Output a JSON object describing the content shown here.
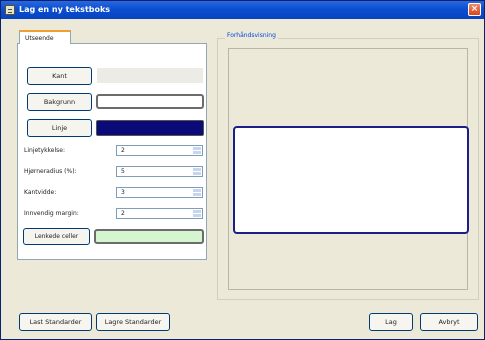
{
  "window": {
    "title": "Lag en ny tekstboks",
    "close_glyph": "×",
    "icon": "app-icon"
  },
  "tab": {
    "label": "Utseende"
  },
  "buttons": {
    "kant": "Kant",
    "bakgrunn": "Bakgrunn",
    "linje": "Linje",
    "lenkede_celler": "Lenkede celler"
  },
  "colors": {
    "kant": "#ecebe6",
    "bakgrunn": "#ffffff",
    "linje": "#0a0a78",
    "lenkede_celler": "#d5f5d0",
    "accent": "#0a4fd0"
  },
  "fields": [
    {
      "label": "Linjetykkelse:",
      "value": "2"
    },
    {
      "label": "Hjørneradius (%):",
      "value": "5"
    },
    {
      "label": "Kantvidde:",
      "value": "3"
    },
    {
      "label": "Innvendig margin:",
      "value": "2"
    }
  ],
  "preview": {
    "label": "Forhåndsvisning"
  },
  "footer": {
    "last_label": "Last Standarder",
    "lagre_label": "Lagre Standarder",
    "lag_label": "Lag",
    "avbryt_label": "Avbryt"
  }
}
